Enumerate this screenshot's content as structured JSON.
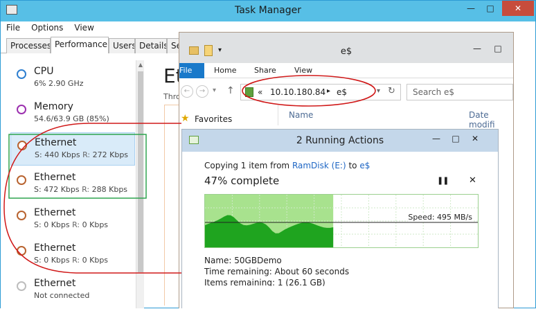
{
  "task_manager": {
    "title": "Task Manager",
    "menu": [
      "File",
      "Options",
      "View"
    ],
    "tabs": [
      "Processes",
      "Performance",
      "Users",
      "Details",
      "Se"
    ],
    "active_tab": "Performance",
    "sidebar": [
      {
        "name": "CPU",
        "sub": "6%  2.90 GHz",
        "color": "#2e7fd0"
      },
      {
        "name": "Memory",
        "sub": "54.6/63.9 GB (85%)",
        "color": "#9b2fae"
      },
      {
        "name": "Ethernet",
        "s_label": "S:",
        "s_val": "440 Kbps",
        "r_label": "R:",
        "r_val": "272 Kbps",
        "color": "#b8632f"
      },
      {
        "name": "Ethernet",
        "s_label": "S:",
        "s_val": "472 Kbps",
        "r_label": "R:",
        "r_val": "288 Kbps",
        "color": "#b8632f"
      },
      {
        "name": "Ethernet",
        "s_label": "S:",
        "s_val": "0 Kbps",
        "r_label": "R:",
        "r_val": "0 Kbps",
        "color": "#b8632f"
      },
      {
        "name": "Ethernet",
        "s_label": "S:",
        "s_val": "0 Kbps",
        "r_label": "R:",
        "r_val": "0 Kbps",
        "color": "#b8632f"
      },
      {
        "name": "Ethernet",
        "sub": "Not connected",
        "color": "#bdbdbd"
      }
    ],
    "detail_title": "Et",
    "detail_sub": "Thro"
  },
  "explorer": {
    "title": "e$",
    "ribbon_tabs": [
      "File",
      "Home",
      "Share",
      "View"
    ],
    "address": {
      "prefix": "«",
      "ip": "10.10.180.84",
      "sep": "▸",
      "folder": "e$"
    },
    "search_placeholder": "Search e$",
    "favorites": "Favorites",
    "columns": {
      "name": "Name",
      "date": "Date modifi"
    }
  },
  "copy_dialog": {
    "title": "2 Running Actions",
    "copying_prefix": "Copying 1 item from ",
    "source": "RamDisk (E:)",
    "to": " to ",
    "dest": "e$",
    "percent_text": "47% complete",
    "progress_fraction": 0.47,
    "speed": "Speed: 495 MB/s",
    "name_label": "Name:",
    "name_value": "50GBDemo",
    "time_label": "Time remaining:",
    "time_value": "About 60 seconds",
    "items_label": "Items remaining:",
    "items_value": "1 (26.1 GB)",
    "colors": {
      "fill": "#a8e28e",
      "line": "#1e8f1e",
      "grid": "#cfe9c8"
    }
  }
}
